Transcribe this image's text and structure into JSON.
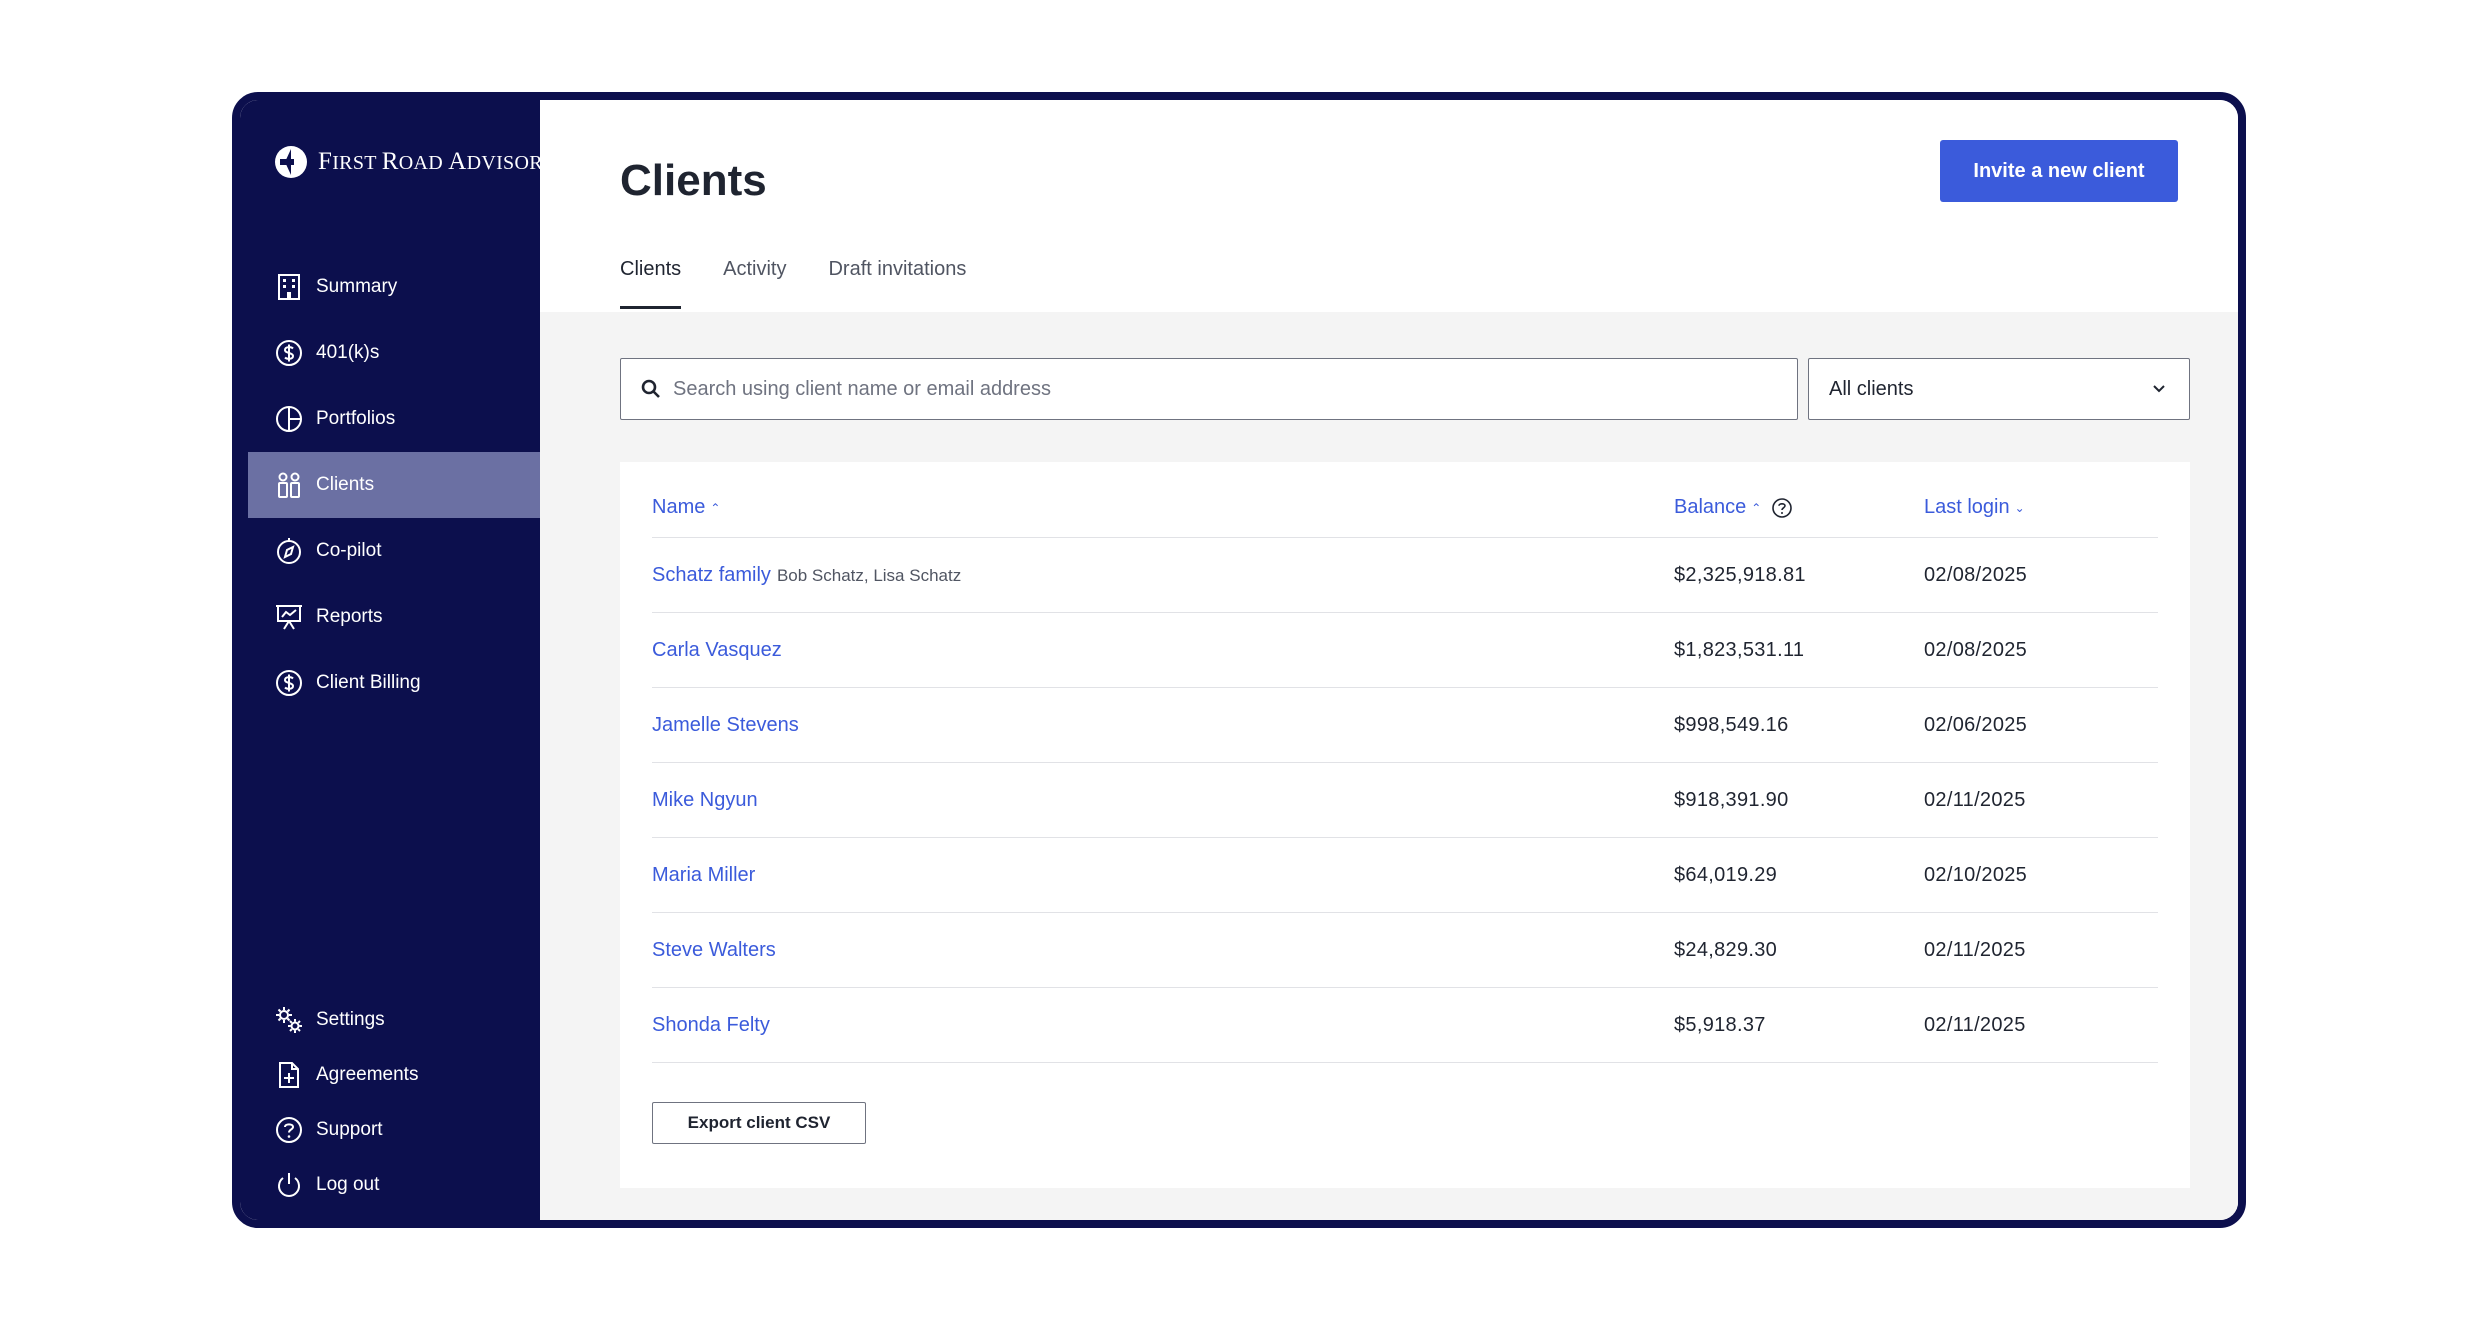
{
  "brand": {
    "logo_first": "F",
    "logo_irst": "IRST",
    "logo_road_r": "R",
    "logo_road": "OAD",
    "logo_adv_a": "A",
    "logo_advisors": "DVISORS"
  },
  "sidebar": {
    "items": [
      {
        "label": "Summary",
        "icon": "building-icon"
      },
      {
        "label": "401(k)s",
        "icon": "dollar-circle-icon"
      },
      {
        "label": "Portfolios",
        "icon": "pie-chart-icon"
      },
      {
        "label": "Clients",
        "icon": "people-icon",
        "active": true
      },
      {
        "label": "Co-pilot",
        "icon": "compass-icon"
      },
      {
        "label": "Reports",
        "icon": "presentation-icon"
      },
      {
        "label": "Client Billing",
        "icon": "dollar-circle-icon"
      }
    ],
    "bottom": [
      {
        "label": "Settings",
        "icon": "gears-icon"
      },
      {
        "label": "Agreements",
        "icon": "document-plus-icon"
      },
      {
        "label": "Support",
        "icon": "question-circle-icon"
      },
      {
        "label": "Log out",
        "icon": "power-icon"
      }
    ]
  },
  "header": {
    "title": "Clients",
    "invite_label": "Invite a new client"
  },
  "tabs": [
    {
      "label": "Clients",
      "active": true
    },
    {
      "label": "Activity",
      "active": false
    },
    {
      "label": "Draft invitations",
      "active": false
    }
  ],
  "search": {
    "placeholder": "Search using client name or email address",
    "value": ""
  },
  "filter": {
    "selected": "All clients"
  },
  "table": {
    "columns": {
      "name": "Name",
      "balance": "Balance",
      "last_login": "Last login"
    },
    "rows": [
      {
        "name": "Schatz family",
        "members": "Bob Schatz, Lisa Schatz",
        "balance": "$2,325,918.81",
        "last_login": "02/08/2025"
      },
      {
        "name": "Carla Vasquez",
        "members": "",
        "balance": "$1,823,531.11",
        "last_login": "02/08/2025"
      },
      {
        "name": "Jamelle Stevens",
        "members": "",
        "balance": "$998,549.16",
        "last_login": "02/06/2025"
      },
      {
        "name": "Mike Ngyun",
        "members": "",
        "balance": "$918,391.90",
        "last_login": "02/11/2025"
      },
      {
        "name": "Maria Miller",
        "members": "",
        "balance": "$64,019.29",
        "last_login": "02/10/2025"
      },
      {
        "name": "Steve Walters",
        "members": "",
        "balance": "$24,829.30",
        "last_login": "02/11/2025"
      },
      {
        "name": "Shonda Felty",
        "members": "",
        "balance": "$5,918.37",
        "last_login": "02/11/2025"
      }
    ],
    "export_label": "Export client CSV"
  },
  "colors": {
    "sidebar_bg": "#0c0f4d",
    "sidebar_active": "#6b70a3",
    "accent": "#3b5bdb"
  }
}
